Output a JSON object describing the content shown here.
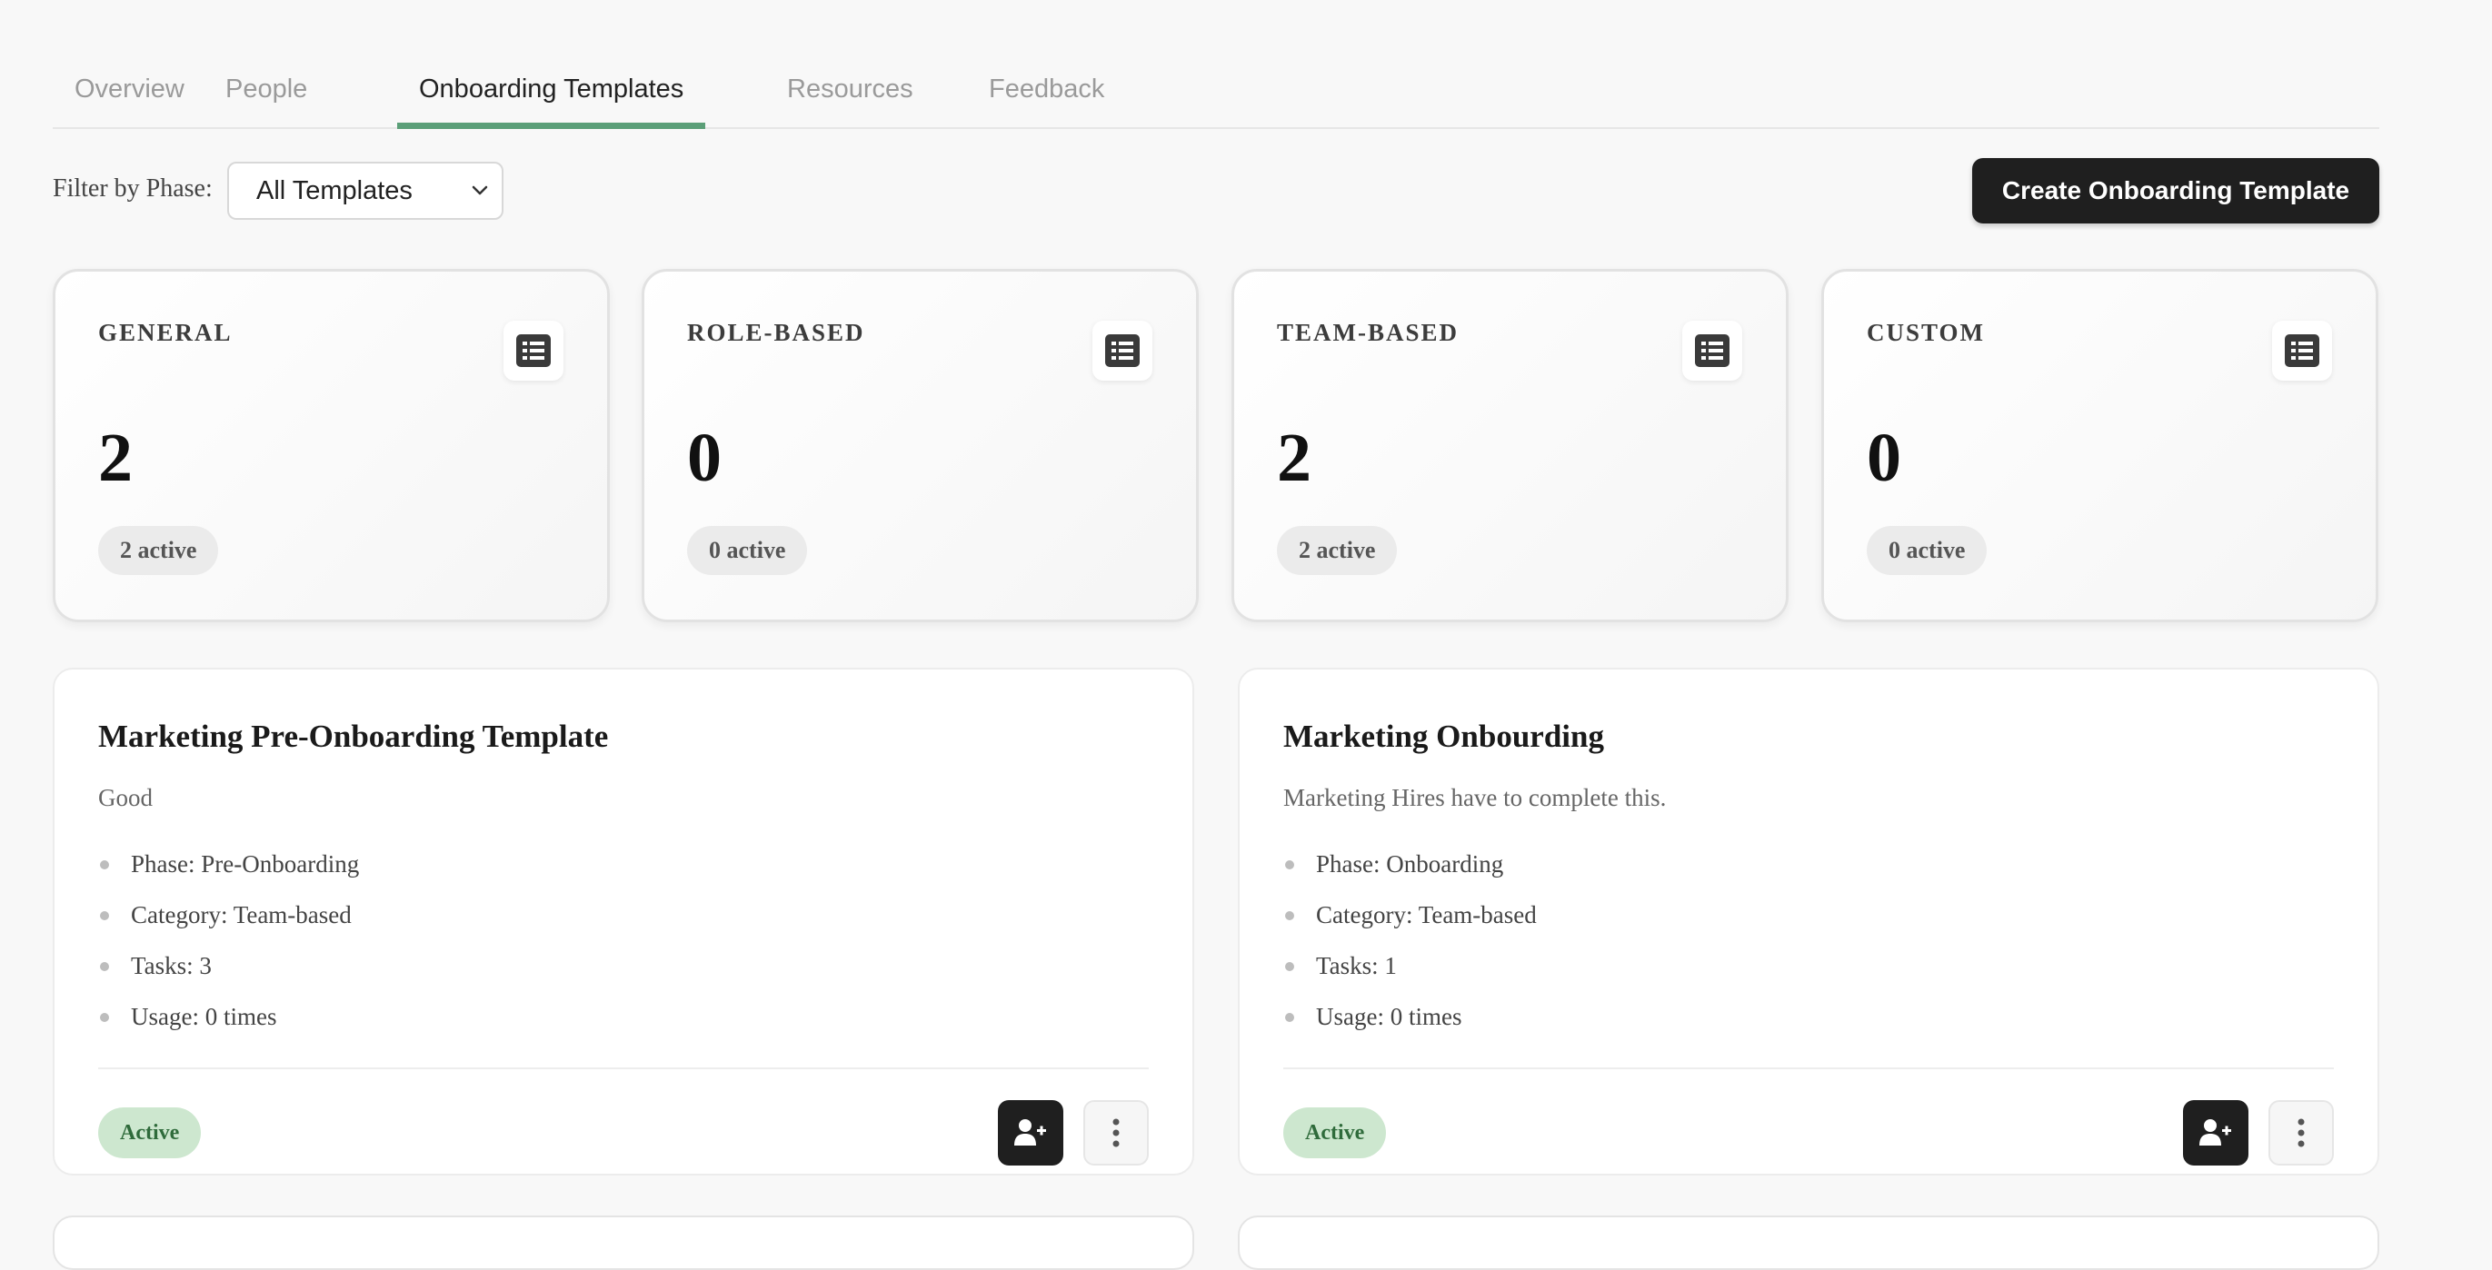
{
  "tabs": [
    {
      "label": "Overview"
    },
    {
      "label": "People"
    },
    {
      "label": "Onboarding Templates"
    },
    {
      "label": "Resources"
    },
    {
      "label": "Feedback"
    }
  ],
  "active_tab": "Onboarding Templates",
  "filter": {
    "label": "Filter by Phase:",
    "selected": "All Templates"
  },
  "create_button": "Create Onboarding Template",
  "stats": [
    {
      "title": "GENERAL",
      "value": "2",
      "badge": "2 active",
      "icon": "list-icon"
    },
    {
      "title": "ROLE-BASED",
      "value": "0",
      "badge": "0 active",
      "icon": "list-icon"
    },
    {
      "title": "TEAM-BASED",
      "value": "2",
      "badge": "2 active",
      "icon": "list-icon"
    },
    {
      "title": "CUSTOM",
      "value": "0",
      "badge": "0 active",
      "icon": "list-icon"
    }
  ],
  "templates": [
    {
      "title": "Marketing Pre-Onboarding Template",
      "description": "Good",
      "details": [
        "Phase: Pre-Onboarding",
        "Category: Team-based",
        "Tasks: 3",
        "Usage: 0 times"
      ],
      "status": "Active",
      "actions": [
        "user-plus-icon",
        "more-vertical-icon"
      ]
    },
    {
      "title": "Marketing Onbourding",
      "description": "Marketing Hires have to complete this.",
      "details": [
        "Phase: Onboarding",
        "Category: Team-based",
        "Tasks: 1",
        "Usage: 0 times"
      ],
      "status": "Active",
      "actions": [
        "user-plus-icon",
        "more-vertical-icon"
      ]
    }
  ],
  "colors": {
    "accent": "#5b9f78",
    "primary_button": "#1f1f1f",
    "status_active_bg": "#cde7cf",
    "status_active_text": "#2f6b3b",
    "page_background": "#f8f8f8"
  }
}
